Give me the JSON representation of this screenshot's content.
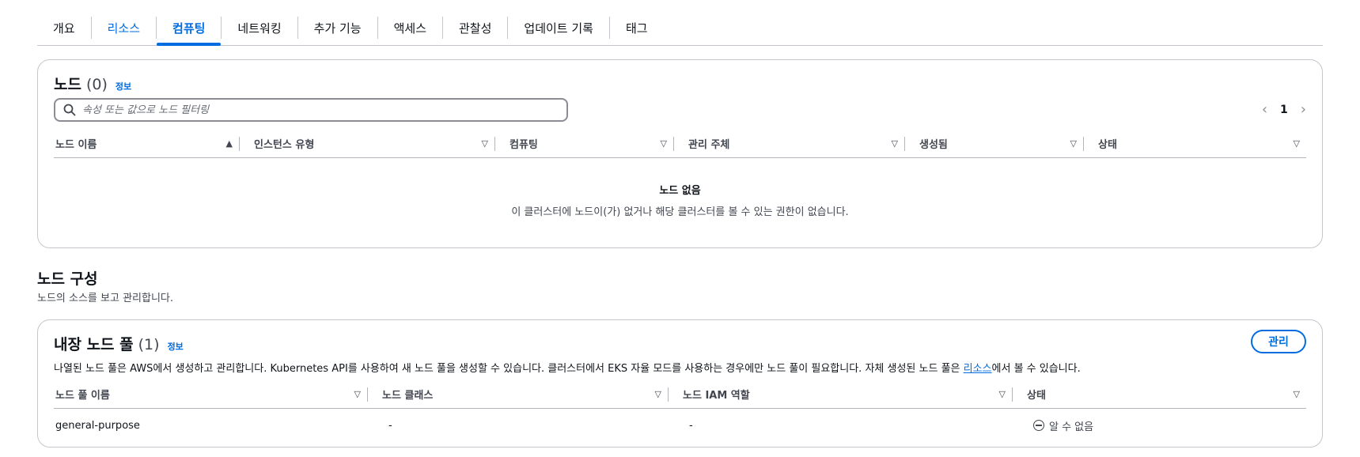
{
  "tabs": [
    {
      "label": "개요"
    },
    {
      "label": "리소스"
    },
    {
      "label": "컴퓨팅"
    },
    {
      "label": "네트워킹"
    },
    {
      "label": "추가 기능"
    },
    {
      "label": "액세스"
    },
    {
      "label": "관찰성"
    },
    {
      "label": "업데이트 기록"
    },
    {
      "label": "태그"
    }
  ],
  "active_tab": "컴퓨팅",
  "nodes": {
    "title": "노드",
    "count": "(0)",
    "info": "정보",
    "search_placeholder": "속성 또는 값으로 노드 필터링",
    "page": "1",
    "columns": [
      "노드 이름",
      "인스턴스 유형",
      "컴퓨팅",
      "관리 주체",
      "생성됨",
      "상태"
    ],
    "empty_title": "노드 없음",
    "empty_desc": "이 클러스터에 노드이(가) 없거나 해당 클러스터를 볼 수 있는 권한이 없습니다."
  },
  "node_config": {
    "title": "노드 구성",
    "desc": "노드의 소스를 보고 관리합니다."
  },
  "builtin_pools": {
    "title": "내장 노드 풀",
    "count": "(1)",
    "info": "정보",
    "manage_label": "관리",
    "desc_before": "나열된 노드 풀은 AWS에서 생성하고 관리합니다. Kubernetes API를 사용하여 새 노드 풀을 생성할 수 있습니다. 클러스터에서 EKS 자율 모드를 사용하는 경우에만 노드 풀이 필요합니다. 자체 생성된 노드 풀은 ",
    "desc_link": "리소스",
    "desc_after": "에서 볼 수 있습니다.",
    "columns": [
      "노드 풀 이름",
      "노드 클래스",
      "노드 IAM 역할",
      "상태"
    ],
    "rows": [
      {
        "name": "general-purpose",
        "node_class": "-",
        "iam_role": "-",
        "status": "알 수 없음"
      }
    ]
  },
  "colors": {
    "accent": "#006ce0",
    "border": "#c6c6cd",
    "text": "#0f141a",
    "muted": "#424650"
  }
}
